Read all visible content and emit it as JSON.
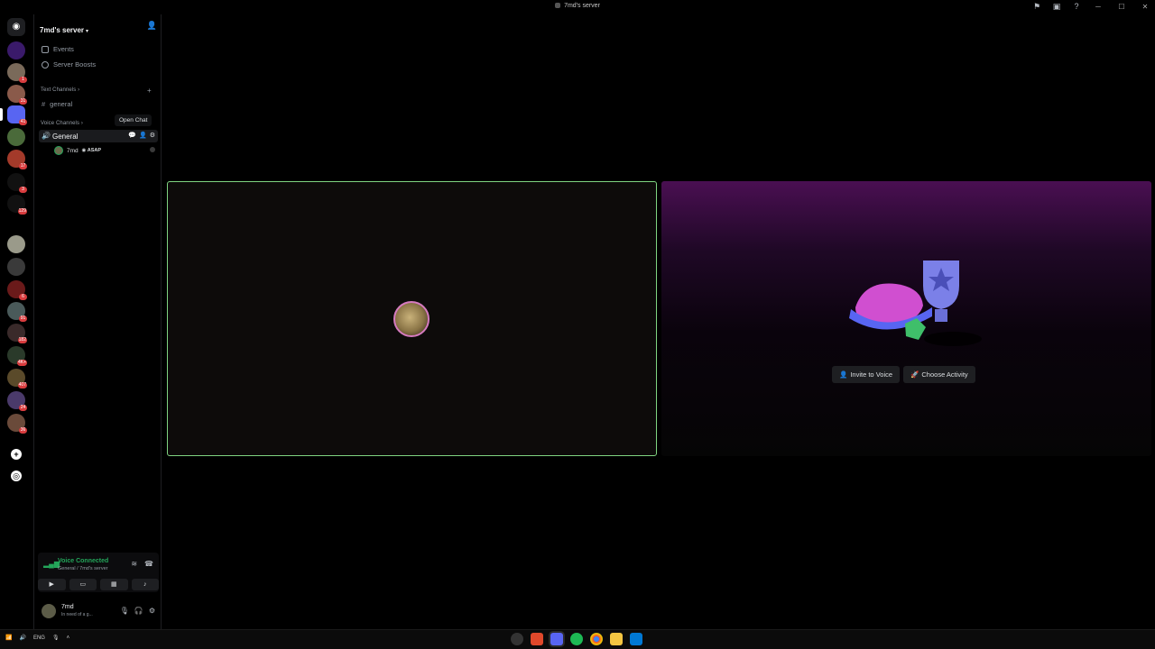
{
  "window": {
    "title": "7md's server"
  },
  "rail": {
    "badges": [
      "1",
      "31",
      "41",
      "17",
      "3",
      "129",
      "6",
      "91",
      "182",
      "4K+",
      "407",
      "24",
      "36"
    ]
  },
  "sidebar": {
    "server_name": "7md's server",
    "nav": [
      {
        "label": "Events",
        "icon": "calendar-icon"
      },
      {
        "label": "Server Boosts",
        "icon": "boost-icon"
      }
    ],
    "text_category": "Text Channels",
    "text_channels": [
      "general"
    ],
    "voice_category": "Voice Channels",
    "voice_channel": "General",
    "tooltip": "Open Chat",
    "voice_user": {
      "name": "7md",
      "tag": "ASAP"
    }
  },
  "voice_panel": {
    "status": "Voice Connected",
    "location": "General / 7md's server"
  },
  "user_panel": {
    "name": "7md",
    "status": "In need of a g..."
  },
  "activity": {
    "invite_label": "Invite to Voice",
    "choose_label": "Choose Activity"
  },
  "taskbar": {
    "lang": "ENG"
  },
  "colors": {
    "accent_green": "#23a55a",
    "speaking_border": "#7fd481",
    "badge_red": "#d83c3e",
    "activity_gradient_top": "#4a0f52"
  }
}
